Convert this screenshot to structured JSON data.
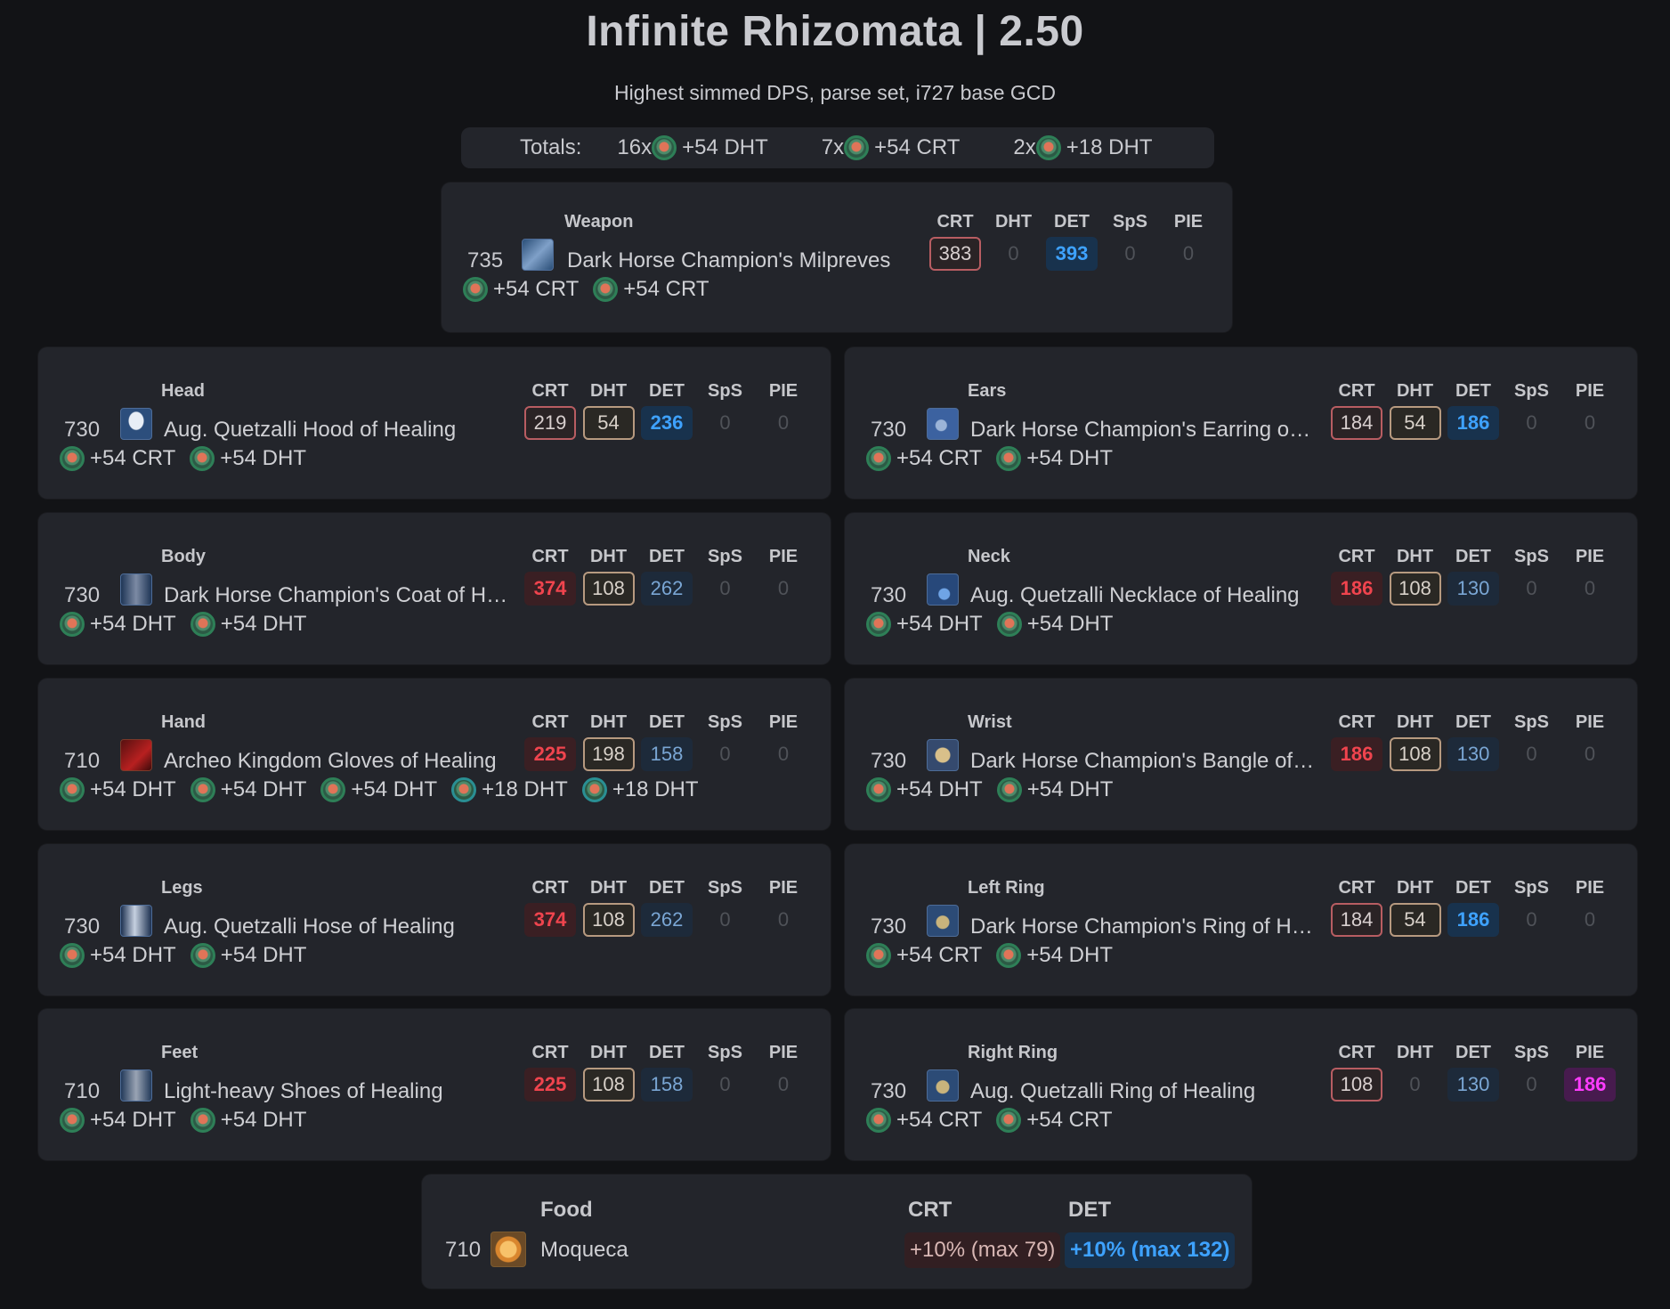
{
  "title": "Infinite Rhizomata | 2.50",
  "subtitle": "Highest simmed DPS, parse set, i727 base GCD",
  "totals": {
    "label": "Totals:",
    "items": [
      {
        "count": "16x",
        "stat": "+54 DHT"
      },
      {
        "count": "7x",
        "stat": "+54 CRT"
      },
      {
        "count": "2x",
        "stat": "+18 DHT"
      }
    ]
  },
  "stat_headers": [
    "CRT",
    "DHT",
    "DET",
    "SpS",
    "PIE"
  ],
  "gear": [
    {
      "slot": "Weapon",
      "ilvl": "735",
      "name": "Dark Horse Champion's Milpreves",
      "icon": "crossed-blades-icon",
      "stats": [
        "383",
        "0",
        "393",
        "0",
        "0"
      ],
      "styles": [
        "crt-outline",
        "zero",
        "det-bold",
        "zero",
        "zero"
      ],
      "melds": [
        "+54 CRT",
        "+54 CRT"
      ]
    },
    {
      "slot": "Head",
      "ilvl": "730",
      "name": "Aug. Quetzalli Hood of Healing",
      "icon": "hood-icon",
      "stats": [
        "219",
        "54",
        "236",
        "0",
        "0"
      ],
      "styles": [
        "crt-outline",
        "dht-outline",
        "det-bold",
        "zero",
        "zero"
      ],
      "melds": [
        "+54 CRT",
        "+54 DHT"
      ]
    },
    {
      "slot": "Ears",
      "ilvl": "730",
      "name": "Dark Horse Champion's Earring of Healing",
      "icon": "earring-icon",
      "stats": [
        "184",
        "54",
        "186",
        "0",
        "0"
      ],
      "styles": [
        "crt-outline",
        "dht-outline",
        "det-bold",
        "zero",
        "zero"
      ],
      "melds": [
        "+54 CRT",
        "+54 DHT"
      ]
    },
    {
      "slot": "Body",
      "ilvl": "730",
      "name": "Dark Horse Champion's Coat of Healing",
      "icon": "coat-icon",
      "stats": [
        "374",
        "108",
        "262",
        "0",
        "0"
      ],
      "styles": [
        "crt-fill",
        "dht-outline",
        "det-dim",
        "zero",
        "zero"
      ],
      "melds": [
        "+54 DHT",
        "+54 DHT"
      ]
    },
    {
      "slot": "Neck",
      "ilvl": "730",
      "name": "Aug. Quetzalli Necklace of Healing",
      "icon": "necklace-icon",
      "stats": [
        "186",
        "108",
        "130",
        "0",
        "0"
      ],
      "styles": [
        "crt-fill",
        "dht-outline",
        "det-dim",
        "zero",
        "zero"
      ],
      "melds": [
        "+54 DHT",
        "+54 DHT"
      ]
    },
    {
      "slot": "Hand",
      "ilvl": "710",
      "name": "Archeo Kingdom Gloves of Healing",
      "icon": "gloves-icon",
      "stats": [
        "225",
        "198",
        "158",
        "0",
        "0"
      ],
      "styles": [
        "crt-fill",
        "dht-outline",
        "det-dim",
        "zero",
        "zero"
      ],
      "melds": [
        "+54 DHT",
        "+54 DHT",
        "+54 DHT",
        "+18 DHT",
        "+18 DHT"
      ]
    },
    {
      "slot": "Wrist",
      "ilvl": "730",
      "name": "Dark Horse Champion's Bangle of Healing",
      "icon": "bangle-icon",
      "stats": [
        "186",
        "108",
        "130",
        "0",
        "0"
      ],
      "styles": [
        "crt-fill",
        "dht-outline",
        "det-dim",
        "zero",
        "zero"
      ],
      "melds": [
        "+54 DHT",
        "+54 DHT"
      ]
    },
    {
      "slot": "Legs",
      "ilvl": "730",
      "name": "Aug. Quetzalli Hose of Healing",
      "icon": "legs-icon",
      "stats": [
        "374",
        "108",
        "262",
        "0",
        "0"
      ],
      "styles": [
        "crt-fill",
        "dht-outline",
        "det-dim",
        "zero",
        "zero"
      ],
      "melds": [
        "+54 DHT",
        "+54 DHT"
      ]
    },
    {
      "slot": "Left Ring",
      "ilvl": "730",
      "name": "Dark Horse Champion's Ring of Healing",
      "icon": "ring-icon",
      "stats": [
        "184",
        "54",
        "186",
        "0",
        "0"
      ],
      "styles": [
        "crt-outline",
        "dht-outline",
        "det-bold",
        "zero",
        "zero"
      ],
      "melds": [
        "+54 CRT",
        "+54 DHT"
      ]
    },
    {
      "slot": "Feet",
      "ilvl": "710",
      "name": "Light-heavy Shoes of Healing",
      "icon": "boots-icon",
      "stats": [
        "225",
        "108",
        "158",
        "0",
        "0"
      ],
      "styles": [
        "crt-fill",
        "dht-outline",
        "det-dim",
        "zero",
        "zero"
      ],
      "melds": [
        "+54 DHT",
        "+54 DHT"
      ]
    },
    {
      "slot": "Right Ring",
      "ilvl": "730",
      "name": "Aug. Quetzalli Ring of Healing",
      "icon": "ring-icon",
      "stats": [
        "108",
        "0",
        "130",
        "0",
        "186"
      ],
      "styles": [
        "crt-outline",
        "zero",
        "det-dim",
        "zero",
        "pie-fill"
      ],
      "melds": [
        "+54 CRT",
        "+54 CRT"
      ]
    }
  ],
  "food": {
    "label": "Food",
    "ilvl": "710",
    "name": "Moqueca",
    "icon": "food-bowl-icon",
    "headers": [
      "CRT",
      "DET"
    ],
    "values": [
      "+10% (max 79)",
      "+10% (max 132)"
    ]
  },
  "colors": {
    "background": "#121316",
    "card": "#23252b",
    "crt": "#f0444e",
    "det": "#3ea2ff",
    "pie": "#ff3cff"
  }
}
